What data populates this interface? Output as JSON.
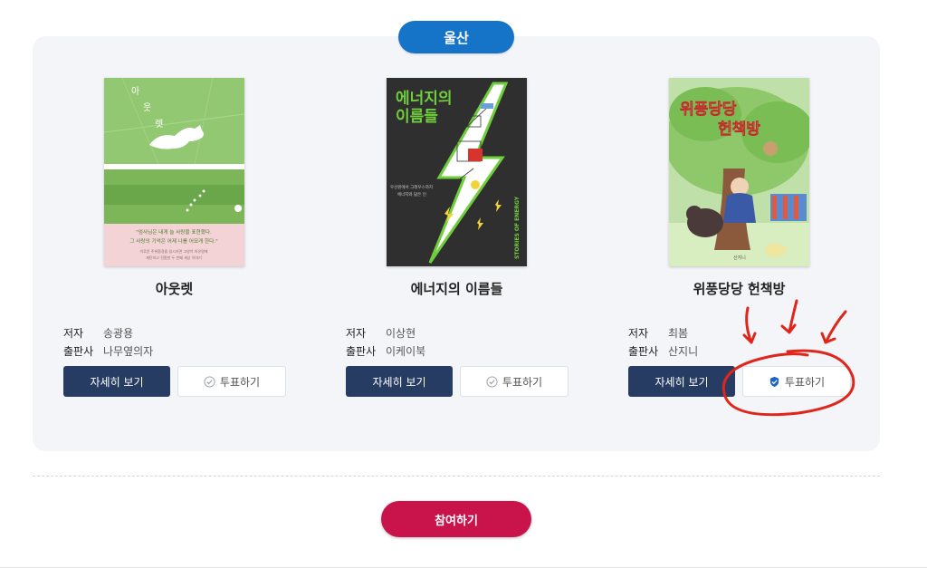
{
  "region": {
    "label": "울산"
  },
  "books": [
    {
      "title": "아웃렛",
      "author_label": "저자",
      "author": "송광용",
      "publisher_label": "출판사",
      "publisher": "나무옆의자",
      "detail_label": "자세히 보기",
      "vote_label": "투표하기",
      "vote_selected": false,
      "cover": {
        "title_chars": [
          "아",
          "웃",
          "렛"
        ],
        "quote_line1": "\"엄사님은 내게 늘 사랑을 표현했다.",
        "quote_line2": "그 사랑의 기억은 어제 나를 어묘게 한다.\"",
        "small_line1": "이루운 주위환경을 읽시키면 고양이 미유명에",
        "small_line2": "재탄하고 전환한 두 번째 세상 이야기"
      }
    },
    {
      "title": "에너지의 이름들",
      "author_label": "저자",
      "author": "이상현",
      "publisher_label": "출판사",
      "publisher": "이케이북",
      "detail_label": "자세히 보기",
      "vote_label": "투표하기",
      "vote_selected": false,
      "cover": {
        "title_line1": "에너지의",
        "title_line2": "이름들",
        "subtitle_line1": "우산원에서 그래우스까지",
        "subtitle_line2": "에너지와 닮은 인",
        "side_text": "STORIES OF ENERGY"
      }
    },
    {
      "title": "위풍당당 헌책방",
      "author_label": "저자",
      "author": "최봄",
      "publisher_label": "출판사",
      "publisher": "산지니",
      "detail_label": "자세히 보기",
      "vote_label": "투표하기",
      "vote_selected": true,
      "cover": {
        "title_line1": "위풍당당",
        "title_line2": "헌책방",
        "publisher_mark": "산지니"
      }
    }
  ],
  "participate": {
    "label": "참여하기"
  },
  "colors": {
    "region_pill": "#1674c8",
    "detail_button": "#263c63",
    "participate_button": "#c8134b",
    "annotation": "#e0261b"
  }
}
